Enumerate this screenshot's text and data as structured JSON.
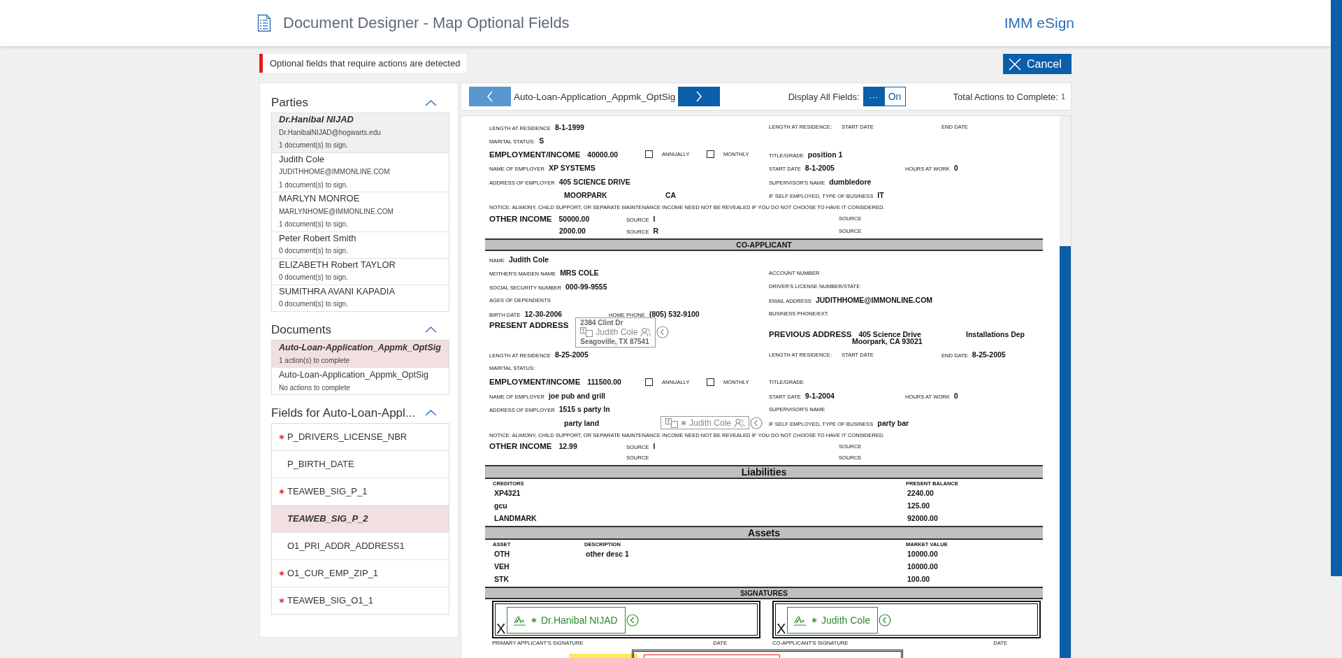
{
  "header": {
    "title": "Document Designer - Map Optional Fields",
    "brand": "IMM eSign"
  },
  "alert": {
    "message": "Optional fields that require actions are detected"
  },
  "cancel_button": {
    "label": "Cancel"
  },
  "parties": {
    "title": "Parties",
    "expanded": true,
    "items": [
      {
        "name": "Dr.Hanibal NIJAD",
        "email": "Dr.HanibalNIJAD@hogwarts.edu",
        "status": "1 document(s) to sign.",
        "selected": true
      },
      {
        "name": "Judith Cole",
        "email": "JUDITHHOME@IMMONLINE.COM",
        "status": "1 document(s) to sign.",
        "selected": false
      },
      {
        "name": "MARLYN MONROE",
        "email": "MARLYNHOME@IMMONLINE.COM",
        "status": "1 document(s) to sign.",
        "selected": false
      },
      {
        "name": "Peter Robert Smith",
        "status": "0 document(s) to sign.",
        "selected": false
      },
      {
        "name": "ELIZABETH Robert TAYLOR",
        "status": "0 document(s) to sign.",
        "selected": false
      },
      {
        "name": "SUMITHRA AVANI KAPADIA",
        "status": "0 document(s) to sign.",
        "selected": false
      }
    ]
  },
  "documents": {
    "title": "Documents",
    "expanded": true,
    "items": [
      {
        "name": "Auto-Loan-Application_Appmk_OptSig",
        "status": "1 action(s) to complete",
        "selected": true
      },
      {
        "name": "Auto-Loan-Application_Appmk_OptSig",
        "status": "No actions to complete",
        "selected": false
      }
    ]
  },
  "fields": {
    "title": "Fields for Auto-Loan-Appl...",
    "expanded": true,
    "items": [
      {
        "name": "P_DRIVERS_LICENSE_NBR",
        "required": true,
        "selected": false
      },
      {
        "name": "P_BIRTH_DATE",
        "required": false,
        "selected": false
      },
      {
        "name": "TEAWEB_SIG_P_1",
        "required": true,
        "selected": false
      },
      {
        "name": "TEAWEB_SIG_P_2",
        "required": false,
        "selected": true
      },
      {
        "name": "O1_PRI_ADDR_ADDRESS1",
        "required": false,
        "selected": false
      },
      {
        "name": "O1_CUR_EMP_ZIP_1",
        "required": true,
        "selected": false
      },
      {
        "name": "TEAWEB_SIG_O1_1",
        "required": true,
        "selected": false
      }
    ]
  },
  "toolbar": {
    "document_name": "Auto-Loan-Application_Appmk_OptSig",
    "display_all": {
      "label": "Display All Fields:",
      "on": true,
      "handle": "···",
      "state": "On"
    },
    "total_actions": {
      "label": "Total Actions to Complete:",
      "count": "1"
    }
  },
  "document": {
    "blocks": [
      {
        "kind": "residence",
        "cells": [
          {
            "label": "LENGTH AT RESIDENCE",
            "value": "8-1-1999"
          },
          {
            "label": "LENGTH AT RESIDENCE:"
          },
          {
            "label": "START DATE"
          },
          {
            "label": "END DATE"
          }
        ]
      },
      {
        "kind": "single",
        "cells": [
          {
            "label": "MARITAL STATUS:",
            "value": "S"
          }
        ]
      },
      {
        "kind": "income",
        "cells": [
          {
            "label": "EMPLOYMENT/INCOME",
            "value": "40000.00",
            "kind": "heading"
          },
          {
            "label": "ANNUALLY",
            "kind": "checkbox",
            "checked": false
          },
          {
            "label": "MONTHLY",
            "kind": "checkbox",
            "checked": false
          },
          {
            "label": "TITLE/GRADE",
            "value": "position 1"
          }
        ]
      },
      {
        "kind": "employer",
        "cells": [
          {
            "label": "NAME OF EMPLOYER",
            "value": "XP SYSTEMS"
          },
          {
            "label": "START DATE",
            "value": "8-1-2005"
          },
          {
            "label": "HOURS AT WORK",
            "value": "0"
          }
        ]
      },
      {
        "kind": "two",
        "cells": [
          {
            "label": "ADDRESS OF EMPLOYER",
            "value": "405 SCIENCE DRIVE"
          },
          {
            "label": "SUPERVISOR'S NAME",
            "value": "dumbledore"
          }
        ]
      },
      {
        "kind": "city",
        "cells": [
          {
            "value": "MOORPARK"
          },
          {
            "value": "CA"
          },
          {
            "label": "IF SELF EMPLOYED, TYPE OF BUSINESS",
            "value": "IT"
          }
        ]
      },
      {
        "kind": "notice",
        "cells": [
          {
            "label": "NOTICE: ALIMONY, CHILD SUPPORT, OR SEPARATE MAINTENANCE INCOME NEED NOT BE REVEALED IF YOU DO NOT CHOOSE TO HAVE IT CONSIDERED."
          }
        ]
      },
      {
        "kind": "other_income",
        "cells": [
          {
            "label": "OTHER INCOME",
            "value": "50000.00",
            "kind": "heading"
          },
          {
            "label": "SOURCE",
            "value": "I"
          },
          {
            "label": "SOURCE"
          }
        ]
      },
      {
        "kind": "income_line",
        "cells": [
          {
            "value": "2000.00"
          },
          {
            "label": "SOURCE",
            "value": "R"
          },
          {
            "label": "SOURCE"
          }
        ]
      },
      {
        "kind": "section",
        "title": "CO-APPLICANT"
      },
      {
        "kind": "single",
        "cells": [
          {
            "label": "NAME",
            "value": "Judith Cole"
          }
        ]
      },
      {
        "kind": "two",
        "cells": [
          {
            "label": "MOTHER'S MAIDEN NAME",
            "value": "MRS COLE"
          },
          {
            "label": "ACCOUNT NUMBER"
          }
        ]
      },
      {
        "kind": "two",
        "cells": [
          {
            "label": "SOCIAL SECURITY NUMBER",
            "value": "000-99-9555"
          },
          {
            "label": "DRIVER'S LICENSE NUMBER/STATE"
          }
        ]
      },
      {
        "kind": "two",
        "cells": [
          {
            "label": "AGES OF DEPENDENTS"
          },
          {
            "label": "EMAIL ADDRESS",
            "value": "JUDITHHOME@IMMONLINE.COM"
          }
        ]
      },
      {
        "kind": "contact",
        "cells": [
          {
            "label": "BIRTH DATE",
            "value": "12-30-2006"
          },
          {
            "label": "HOME PHONE",
            "value": "(805) 532-9100"
          },
          {
            "label": "BUSINESS PHONE/EXT."
          }
        ]
      },
      {
        "kind": "address",
        "cells": [
          {
            "label": "PRESENT ADDRESS",
            "kind": "heading",
            "value_lines": [
              "2384 Clint Dr",
              "Seagoville, TX 87541"
            ],
            "marker": {
              "signer": "Judith Cole",
              "required": false
            }
          },
          {
            "label": "PREVIOUS ADDRESS",
            "kind": "heading",
            "value": "405 Science Drive"
          },
          {
            "value": "Installations Dep"
          }
        ]
      },
      {
        "kind": "prev_city",
        "cells": [
          {
            "value": "Moorpark, CA 93021"
          }
        ]
      },
      {
        "kind": "residence",
        "cells": [
          {
            "label": "LENGTH AT RESIDENCE",
            "value": "8-25-2005"
          },
          {
            "label": "LENGTH AT RESIDENCE:"
          },
          {
            "label": "START DATE"
          },
          {
            "label": "END DATE",
            "value": "8-25-2005"
          }
        ]
      },
      {
        "kind": "single",
        "cells": [
          {
            "label": "MARITAL STATUS:"
          }
        ]
      },
      {
        "kind": "income",
        "cells": [
          {
            "label": "EMPLOYMENT/INCOME",
            "value": "111500.00",
            "kind": "heading"
          },
          {
            "label": "ANNUALLY",
            "kind": "checkbox",
            "checked": false
          },
          {
            "label": "MONTHLY",
            "kind": "checkbox",
            "checked": false
          },
          {
            "label": "TITLE/GRADE"
          }
        ]
      },
      {
        "kind": "employer",
        "cells": [
          {
            "label": "NAME OF EMPLOYER",
            "value": "joe pub and grill"
          },
          {
            "label": "START DATE",
            "value": "9-1-2004"
          },
          {
            "label": "HOURS AT WORK",
            "value": "0"
          }
        ]
      },
      {
        "kind": "two",
        "cells": [
          {
            "label": "ADDRESS OF EMPLOYER",
            "value": "1515 s party ln"
          },
          {
            "label": "SUPERVISOR'S NAME"
          }
        ]
      },
      {
        "kind": "continuation",
        "cells": [
          {
            "value": "party land"
          },
          {
            "label": "IF SELF EMPLOYED, TYPE OF BUSINESS",
            "value": "party bar"
          }
        ],
        "marker": {
          "signer": "Judith Cole",
          "required": true
        }
      },
      {
        "kind": "notice",
        "cells": [
          {
            "label": "NOTICE: ALIMONY, CHILD SUPPORT, OR SEPARATE MAINTENANCE INCOME NEED NOT BE REVEALED IF YOU DO NOT CHOOSE TO HAVE IT CONSIDERED."
          }
        ]
      },
      {
        "kind": "other_income",
        "cells": [
          {
            "label": "OTHER INCOME",
            "value": "12.99",
            "kind": "heading"
          },
          {
            "label": "SOURCE",
            "value": "I"
          },
          {
            "label": "SOURCE"
          }
        ]
      },
      {
        "kind": "source_line",
        "cells": [
          {
            "label": "SOURCE"
          },
          {
            "label": "SOURCE"
          }
        ]
      },
      {
        "kind": "section_major",
        "title": "Liabilities"
      },
      {
        "kind": "table",
        "columns": [
          "CREDITORS",
          "PRESENT BALANCE"
        ],
        "rows": [
          [
            "XP4321",
            "2240.00"
          ],
          [
            "gcu",
            "125.00"
          ],
          [
            "LANDMARK",
            "92000.00"
          ]
        ]
      },
      {
        "kind": "section_major",
        "title": "Assets"
      },
      {
        "kind": "table",
        "columns": [
          "ASSET",
          "DESCRIPTION",
          "MARKET VALUE"
        ],
        "rows": [
          [
            "OTH",
            "other desc 1",
            "10000.00"
          ],
          [
            "VEH",
            null,
            "10000.00"
          ],
          [
            "STK",
            null,
            "100.00"
          ]
        ]
      },
      {
        "kind": "section",
        "title": "SIGNATURES"
      },
      {
        "kind": "signatures",
        "boxes": [
          {
            "mark": "X",
            "signer": "Dr.Hanibal NIJAD",
            "required": true,
            "caption": "PRIMARY APPLICANT'S SIGNATURE",
            "date_label": "DATE"
          },
          {
            "mark": "X",
            "signer": "Judith Cole",
            "required": true,
            "caption": "CO-APPLICANT'S SIGNATURE",
            "date_label": "DATE"
          }
        ]
      },
      {
        "kind": "partial_form"
      }
    ]
  }
}
